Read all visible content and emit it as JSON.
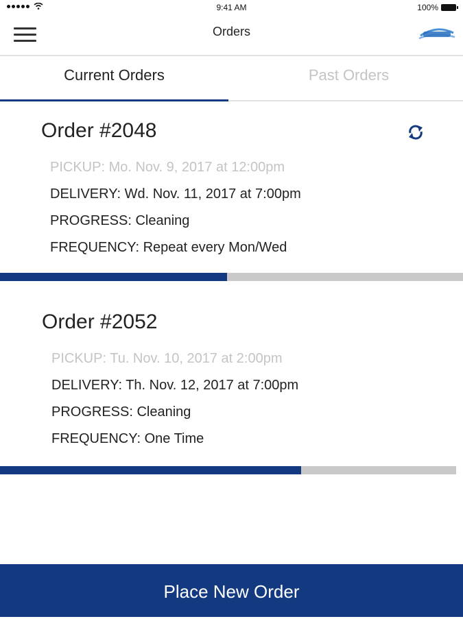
{
  "status_bar": {
    "time": "9:41 AM",
    "battery": "100%",
    "icons": [
      "signal-dots-icon",
      "wifi-icon",
      "battery-icon"
    ]
  },
  "nav": {
    "title": "Orders",
    "menu_icon": "hamburger-menu-icon",
    "logo_icon": "brand-logo-icon"
  },
  "tabs": [
    {
      "label": "Current Orders",
      "active": true
    },
    {
      "label": "Past Orders",
      "active": false
    }
  ],
  "orders": [
    {
      "title": "Order #2048",
      "pickup": "PICKUP: Mo. Nov. 9, 2017 at 12:00pm",
      "delivery": "DELIVERY: Wd. Nov. 11, 2017 at 7:00pm",
      "progress_label": "PROGRESS: Cleaning",
      "frequency": "FREQUENCY: Repeat every Mon/Wed",
      "progress_fraction": 0.49,
      "repeat_icon": "refresh-icon"
    },
    {
      "title": "Order #2052",
      "pickup": "PICKUP: Tu. Nov. 10, 2017 at 2:00pm",
      "delivery": "DELIVERY: Th. Nov. 12, 2017 at 7:00pm",
      "progress_label": "PROGRESS: Cleaning",
      "frequency": "FREQUENCY: One Time",
      "progress_fraction": 0.66
    }
  ],
  "actions": {
    "place_order_label": "Place New Order"
  },
  "colors": {
    "accent": "#133a80",
    "muted_text": "#c4c4c4",
    "track": "#c9c9c9"
  }
}
